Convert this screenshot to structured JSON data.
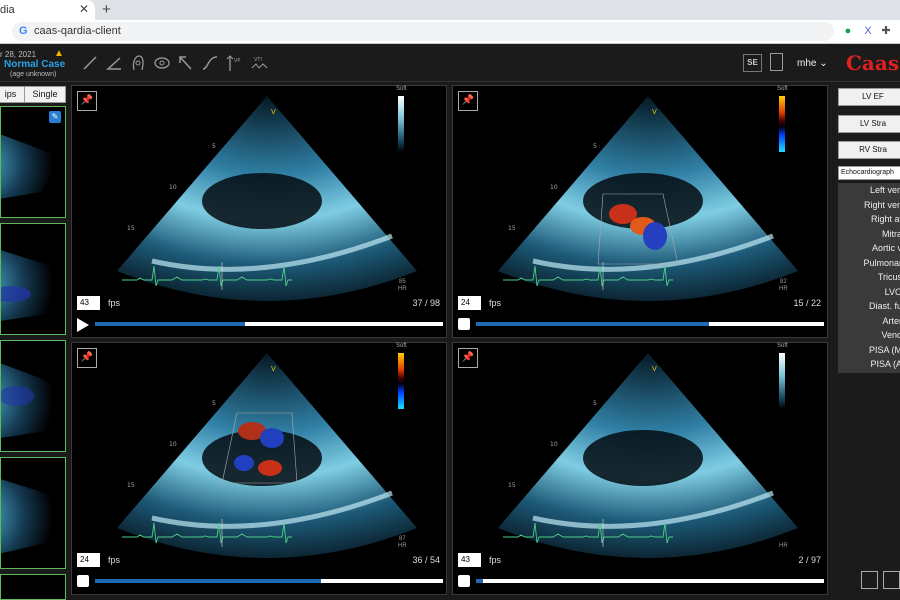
{
  "browser": {
    "tab_title": "dia",
    "url": "caas-qardia-client"
  },
  "header": {
    "case_date": "r 28, 2021",
    "case_name": "Normal Case",
    "case_age": "(age unknown)",
    "se_label": "SE",
    "user": "mhe ⌄",
    "brand": "Caas",
    "brand_tail": "c"
  },
  "sidebar": {
    "btn_clips": "ips",
    "btn_single": "Single"
  },
  "viewports": [
    {
      "fps": "43",
      "fps_label": "fps",
      "frame": "37 / 98",
      "progress": 0.43,
      "hr": "85",
      "playing": false,
      "colorbar": "gray"
    },
    {
      "fps": "24",
      "fps_label": "fps",
      "frame": "15 / 22",
      "progress": 0.67,
      "hr": "82",
      "playing": true,
      "colorbar": "color"
    },
    {
      "fps": "24",
      "fps_label": "fps",
      "frame": "36 / 54",
      "progress": 0.65,
      "hr": "87",
      "playing": true,
      "colorbar": "color"
    },
    {
      "fps": "43",
      "fps_label": "fps",
      "frame": "2 / 97",
      "progress": 0.02,
      "hr": "",
      "playing": true,
      "colorbar": "gray"
    }
  ],
  "common": {
    "depth_5": "5",
    "depth_10": "10",
    "depth_15": "15",
    "hr_label": "HR",
    "lut_label": "Soft",
    "marker": "V"
  },
  "right_panel": {
    "buttons": [
      "LV EF",
      "LV Stra",
      "RV Stra"
    ],
    "dropdown": "Echocardiograph",
    "items": [
      "Left ven",
      "Right ven",
      "Right at",
      "Mitra",
      "Aortic v",
      "Pulmonar",
      "Tricus",
      "LVO",
      "Diast. fu",
      "Arter",
      "Veno",
      "PISA (M",
      "PISA (A"
    ]
  },
  "colors": {
    "accent_blue": "#2aa3e6",
    "brand_red": "#e02020",
    "progress": "#2269b3",
    "thumb_border": "#5cba5c"
  }
}
